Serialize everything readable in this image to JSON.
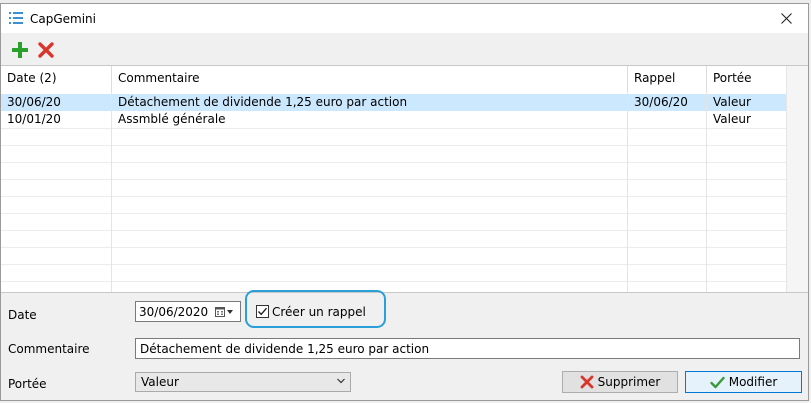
{
  "window": {
    "title": "CapGemini"
  },
  "toolbar": {
    "add_icon": "plus-icon",
    "delete_icon": "x-icon"
  },
  "grid": {
    "columns": [
      {
        "label": "Date (2)"
      },
      {
        "label": "Commentaire"
      },
      {
        "label": "Rappel"
      },
      {
        "label": "Portée"
      }
    ],
    "rows": [
      {
        "date": "30/06/20",
        "comment": "Détachement de dividende 1,25 euro par action",
        "reminder": "30/06/20",
        "scope": "Valeur",
        "selected": true
      },
      {
        "date": "10/01/20",
        "comment": "Assmblé générale",
        "reminder": "",
        "scope": "Valeur",
        "selected": false
      }
    ]
  },
  "form": {
    "date_label": "Date",
    "date_value": "30/06/2020",
    "reminder_checkbox_label": "Créer un rappel",
    "reminder_checked": true,
    "comment_label": "Commentaire",
    "comment_value": "Détachement de dividende 1,25 euro par action",
    "scope_label": "Portée",
    "scope_value": "Valeur"
  },
  "buttons": {
    "delete_label": "Supprimer",
    "modify_label": "Modifier"
  },
  "colors": {
    "selection": "#cce8ff",
    "highlight_border": "#2a9fd8",
    "add_green": "#2ca02c",
    "delete_red": "#d9362b"
  }
}
